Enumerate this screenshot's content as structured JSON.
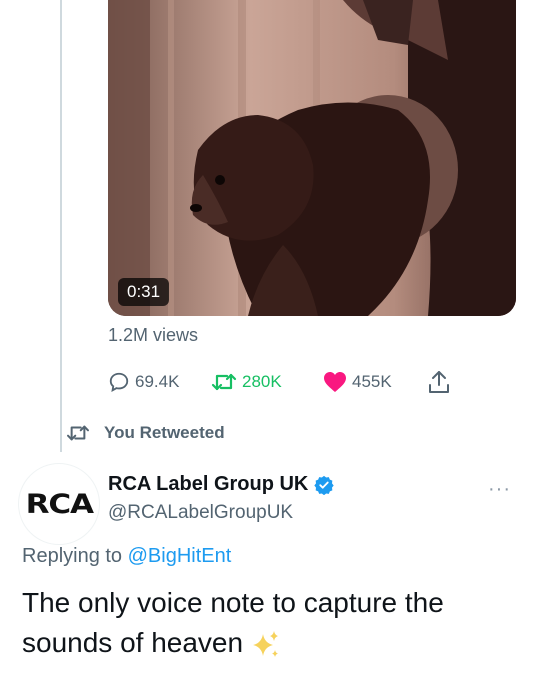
{
  "video": {
    "duration": "0:31",
    "views": "1.2M views"
  },
  "actions": {
    "reply_count": "69.4K",
    "retweet_count": "280K",
    "like_count": "455K"
  },
  "retweet_banner": "You Retweeted",
  "tweet": {
    "avatar_text": "RCA",
    "display_name": "RCA Label Group UK",
    "handle": "@RCALabelGroupUK",
    "more": "···",
    "replying_prefix": "Replying to ",
    "replying_to": "@BigHitEnt",
    "text_line1": "The only voice note to capture the",
    "text_line2": "sounds of heaven"
  },
  "colors": {
    "retweet_green": "#17bf63",
    "like_red": "#f91880",
    "verified_blue": "#1d9bf0",
    "link_blue": "#1d9bf0"
  },
  "icons": [
    "reply-icon",
    "retweet-icon",
    "heart-icon",
    "share-icon",
    "verified-badge-icon",
    "sparkles-icon"
  ]
}
